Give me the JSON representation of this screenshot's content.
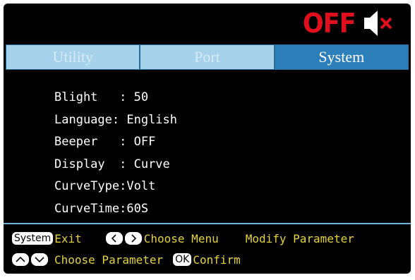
{
  "status": {
    "power_text": "OFF",
    "icon": "speaker-muted-icon",
    "colors": {
      "power": "#e10f1d",
      "background": "#000000"
    }
  },
  "tabs": [
    {
      "label": "Utility",
      "active": false
    },
    {
      "label": "Port",
      "active": false
    },
    {
      "label": "System",
      "active": true
    }
  ],
  "params": [
    {
      "label": "Blight   : ",
      "value": "50"
    },
    {
      "label": "Language: ",
      "value": "English"
    },
    {
      "label": "Beeper   : ",
      "value": "OFF"
    },
    {
      "label": "Display  : ",
      "value": "Curve"
    },
    {
      "label": "CurveType:",
      "value": "Volt"
    },
    {
      "label": "CurveTime:",
      "value": "60S"
    }
  ],
  "help": {
    "system_key": "System",
    "exit": "Exit",
    "choose_menu": "Choose Menu",
    "modify_parameter": "Modify Parameter",
    "choose_parameter": "Choose Parameter",
    "ok_key": "OK",
    "confirm": "Confirm",
    "key_icons": [
      "left-arrow-key-icon",
      "right-arrow-key-icon",
      "up-arrow-key-icon",
      "down-arrow-key-icon"
    ]
  }
}
